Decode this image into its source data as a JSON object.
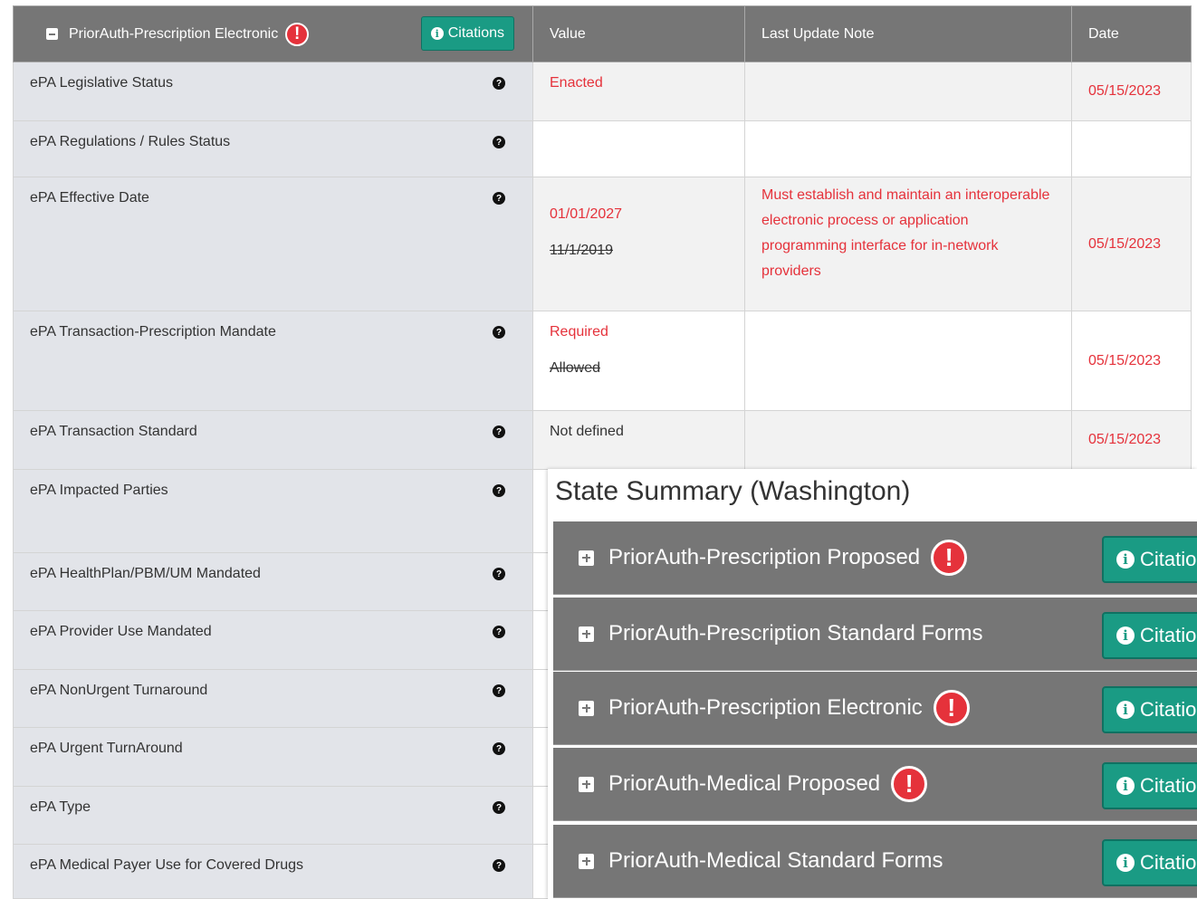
{
  "table": {
    "section_title": "PriorAuth-Prescription Electronic",
    "citations_label": "Citations",
    "columns": [
      "Value",
      "Last Update Note",
      "Date"
    ],
    "rows": [
      {
        "label": "ePA Legislative Status",
        "value": "Enacted",
        "old_value": "",
        "note": "",
        "date": "05/15/2023"
      },
      {
        "label": "ePA Regulations / Rules Status",
        "value": "",
        "old_value": "",
        "note": "",
        "date": ""
      },
      {
        "label": "ePA Effective Date",
        "value": "01/01/2027",
        "old_value": "11/1/2019",
        "note": "Must establish and maintain an interoperable electronic process or application programming interface for in-network providers",
        "date": "05/15/2023"
      },
      {
        "label": "ePA Transaction-Prescription Mandate",
        "value": "Required",
        "old_value": "Allowed",
        "note": "",
        "date": "05/15/2023"
      },
      {
        "label": "ePA Transaction Standard",
        "value": "Not defined",
        "old_value": "",
        "note": "",
        "date": "05/15/2023"
      },
      {
        "label": "ePA Impacted Parties"
      },
      {
        "label": "ePA HealthPlan/PBM/UM Mandated"
      },
      {
        "label": "ePA Provider Use Mandated"
      },
      {
        "label": "ePA NonUrgent Turnaround"
      },
      {
        "label": "ePA Urgent TurnAround"
      },
      {
        "label": "ePA Type"
      },
      {
        "label": "ePA Medical Payer Use for Covered Drugs"
      }
    ]
  },
  "summary": {
    "title": "State Summary (Washington)",
    "citations_label": "Citations",
    "items": [
      {
        "label": "PriorAuth-Prescription Proposed",
        "alert": true
      },
      {
        "label": "PriorAuth-Prescription Standard Forms",
        "alert": false
      },
      {
        "label": "PriorAuth-Prescription Electronic",
        "alert": true
      },
      {
        "label": "PriorAuth-Medical Proposed",
        "alert": true
      },
      {
        "label": "PriorAuth-Medical Standard Forms",
        "alert": false
      }
    ]
  },
  "icons": {
    "help": "question-circle-icon",
    "alert": "exclamation-circle-icon",
    "info": "info-circle-icon",
    "expand": "plus-square-icon",
    "collapse": "minus-square-icon"
  },
  "colors": {
    "header_bg": "#767676",
    "citations_bg": "#1a9b84",
    "alert_red": "#e5323b",
    "label_bg": "#e2e4e9"
  }
}
